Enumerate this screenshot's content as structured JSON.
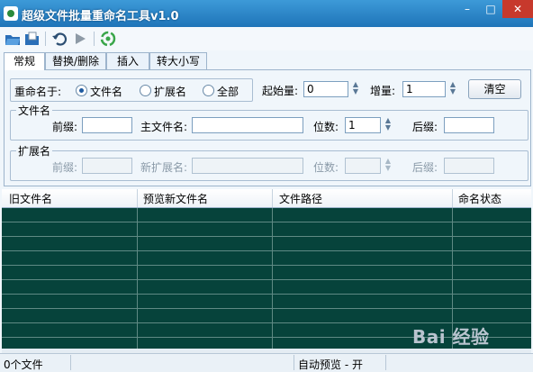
{
  "window": {
    "title": "超级文件批量重命名工具v1.0",
    "controls": {
      "minimize": "–",
      "maximize": "□",
      "close": "✕"
    }
  },
  "toolbar": {
    "icons": [
      "open-folder-icon",
      "open-file-icon",
      "undo-icon",
      "run-icon",
      "recycle-icon"
    ]
  },
  "tabs": [
    "常规",
    "替换/删除",
    "插入",
    "转大小写"
  ],
  "active_tab": "常规",
  "rename_scope": {
    "label": "重命名于:",
    "options": [
      "文件名",
      "扩展名",
      "全部"
    ],
    "selected": "文件名"
  },
  "counter": {
    "start_label": "起始量:",
    "start_value": "0",
    "step_label": "增量:",
    "step_value": "1",
    "clear_button": "清空"
  },
  "filename_group": {
    "title": "文件名",
    "prefix_label": "前缀:",
    "prefix_value": "",
    "main_label": "主文件名:",
    "main_value": "",
    "digits_label": "位数:",
    "digits_value": "1",
    "suffix_label": "后缀:",
    "suffix_value": ""
  },
  "extension_group": {
    "title": "扩展名",
    "prefix_label": "前缀:",
    "prefix_value": "",
    "new_ext_label": "新扩展名:",
    "new_ext_value": "",
    "digits_label": "位数:",
    "digits_value": "",
    "suffix_label": "后缀:",
    "suffix_value": ""
  },
  "table": {
    "columns": [
      "旧文件名",
      "预览新文件名",
      "文件路径",
      "命名状态"
    ],
    "rows": [],
    "background_color": "#06433b"
  },
  "status_bar": {
    "file_count": "0个文件",
    "preview": "自动预览 - 开"
  },
  "watermark": "Bai 经验",
  "colors": {
    "title_bar": "#2a84c8",
    "close_button": "#c7392c",
    "grid_background": "#06433b"
  }
}
